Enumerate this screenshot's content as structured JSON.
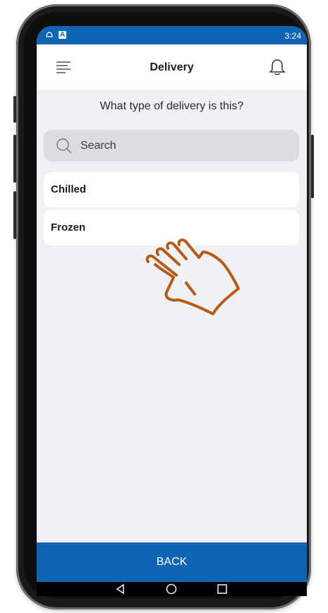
{
  "status_bar": {
    "time": "3:24",
    "icons": [
      "notification-icon",
      "keyboard-icon"
    ]
  },
  "app_bar": {
    "title": "Delivery",
    "menu_icon": "hamburger-menu-icon",
    "bell_icon": "bell-icon"
  },
  "question": "What type of delivery is this?",
  "search": {
    "placeholder": "Search",
    "icon": "search-icon"
  },
  "options": [
    {
      "label": "Chilled"
    },
    {
      "label": "Frozen"
    }
  ],
  "overlay": {
    "icon": "pointing-hand-icon",
    "color": "#b75a16"
  },
  "back_button": {
    "label": "BACK"
  },
  "nav_bar": {
    "icons": [
      "back-triangle-icon",
      "home-circle-icon",
      "recents-square-icon"
    ]
  },
  "colors": {
    "brand": "#0f64b4",
    "background": "#eff1f5",
    "search_bg": "#dcdde1"
  }
}
